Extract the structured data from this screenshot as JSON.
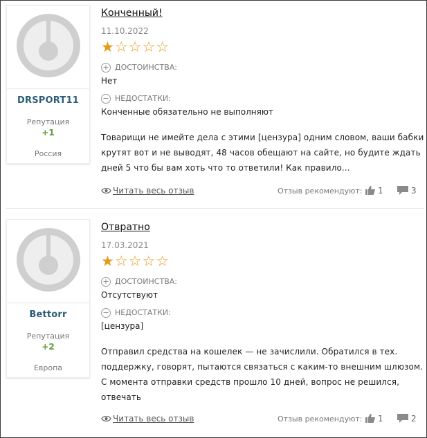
{
  "labels": {
    "pros": "ДОСТОИНСТВА:",
    "cons": "НЕДОСТАТКИ:",
    "reputation": "Репутация",
    "read_full": "Читать весь отзыв",
    "recommend": "Отзыв рекомендуют:"
  },
  "colors": {
    "username": "#2b5d78",
    "reputation_value": "#5e9a3a",
    "star_filled": "#e59a1a"
  },
  "reviews": [
    {
      "user": {
        "name": "DRSPORT11",
        "reputation": "+1",
        "location": "Россия"
      },
      "title": "Конченный!",
      "date": "11.10.2022",
      "rating": 1,
      "rating_max": 5,
      "pros": "Нет",
      "cons": "Конченные обязательно не выполняют",
      "body": "Товарищи не имейте дела с этими [цензура] одним словом, ваши бабки крутят вот и не выводят, 48 часов обещают на сайте, но будите ждать дней 5 что бы вам хоть что то ответили! Как правило...",
      "likes": "1",
      "comments": "3"
    },
    {
      "user": {
        "name": "Bettorr",
        "reputation": "+2",
        "location": "Европа"
      },
      "title": "Отвратно",
      "date": "17.03.2021",
      "rating": 1,
      "rating_max": 5,
      "pros": "Отсутствуют",
      "cons": "[цензура]",
      "body": "Отправил средства на кошелек — не зачислили. Обратился в тех. поддержку, говорят, пытаются связаться с каким-то внешним шлюзом. С момента отправки средств прошло 10 дней, вопрос не решился, отвечать",
      "likes": "1",
      "comments": "2"
    }
  ]
}
